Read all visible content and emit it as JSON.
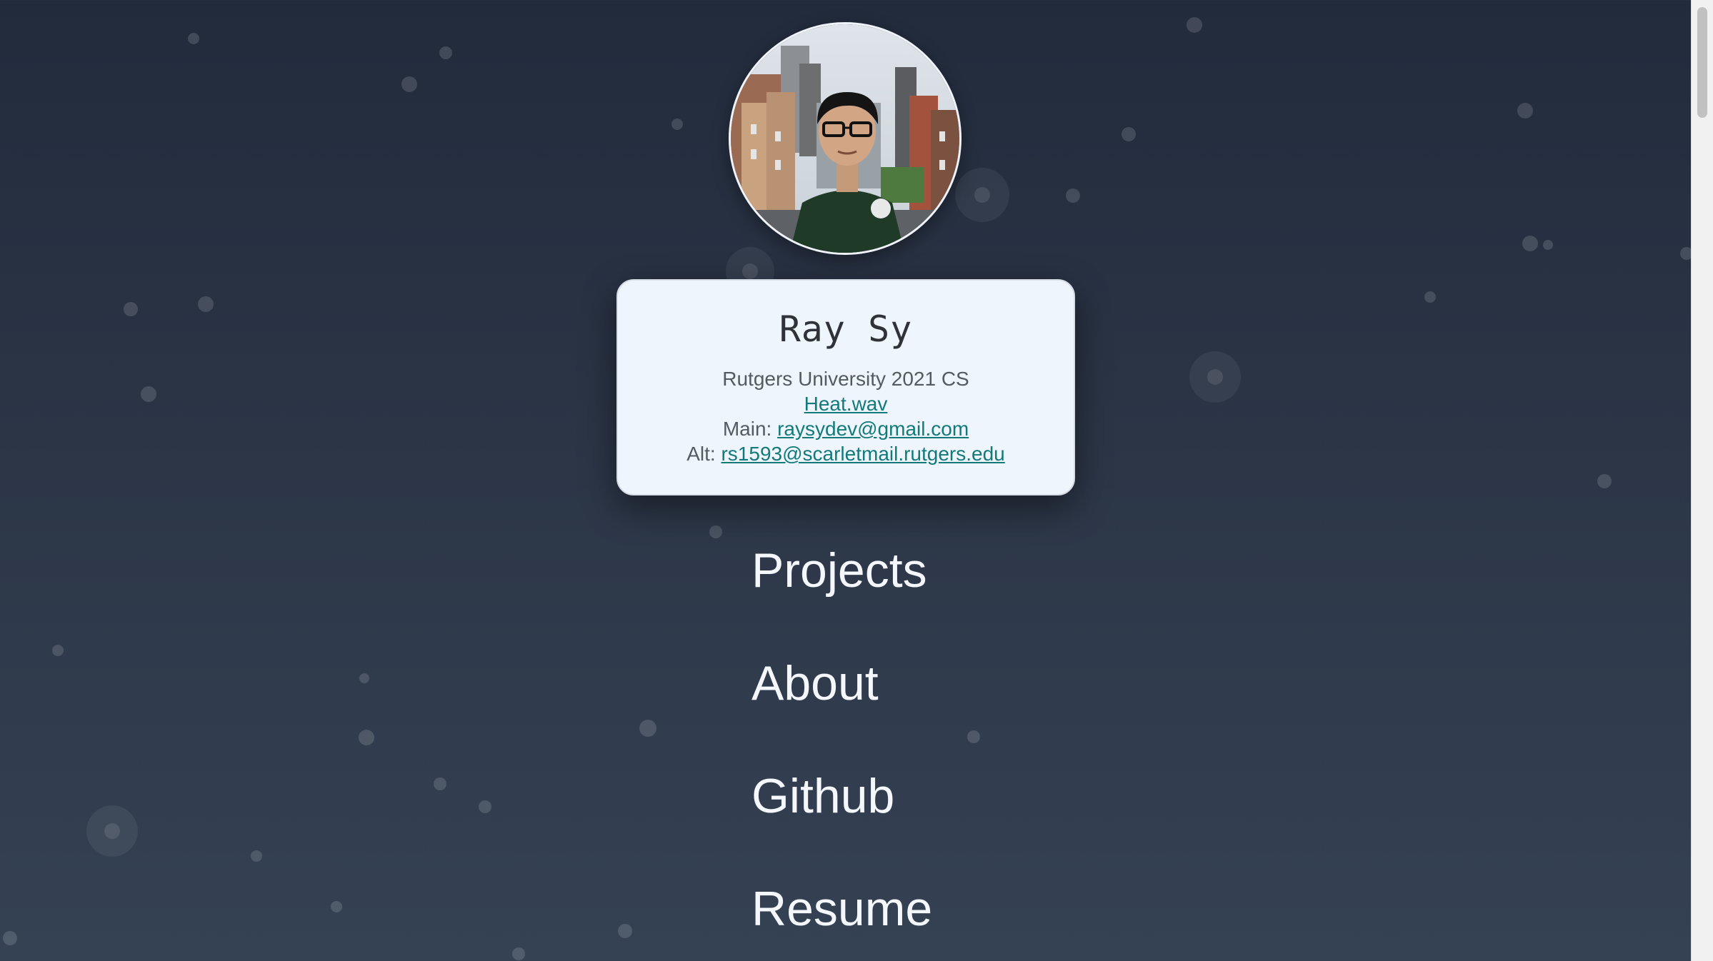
{
  "profile": {
    "name": "Ray Sy",
    "school": "Rutgers University 2021 CS",
    "project_link": "Heat.wav",
    "main_label": "Main:",
    "main_email": "raysydev@gmail.com",
    "alt_label": "Alt:",
    "alt_email": "rs1593@scarletmail.rutgers.edu",
    "avatar_alt": "Ray Sy"
  },
  "nav": {
    "items": [
      "Projects",
      "About",
      "Github",
      "Resume"
    ]
  },
  "colors": {
    "background_top": "#222b3c",
    "background_bottom": "#354254",
    "card": "#eef5fc",
    "link": "#137a7b",
    "nav_text": "#f4f7fb"
  }
}
